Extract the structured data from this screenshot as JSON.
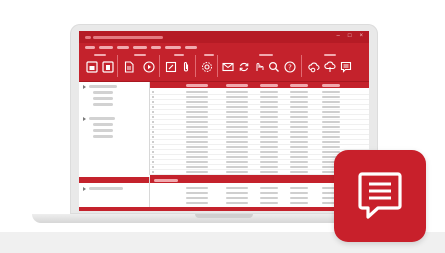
{
  "titlebar": {
    "controls": [
      "–",
      "□",
      "×"
    ]
  },
  "colors": {
    "brand_red": "#c4222c",
    "title_red": "#b51b25",
    "icon_red": "#c8202b",
    "placeholder_text": "#cfcfcf"
  },
  "ribbon": {
    "buttons": [
      "save-icon",
      "copy-icon",
      "document-icon",
      "play-icon",
      "edit-icon",
      "attachment-icon",
      "settings-icon",
      "mail-icon",
      "sync-icon",
      "scan-icon",
      "search-icon",
      "help-icon",
      "cloud-download-icon",
      "cloud-upload-icon",
      "note-icon"
    ]
  },
  "app_icon": {
    "icon": "speech-bubble-document-icon"
  }
}
